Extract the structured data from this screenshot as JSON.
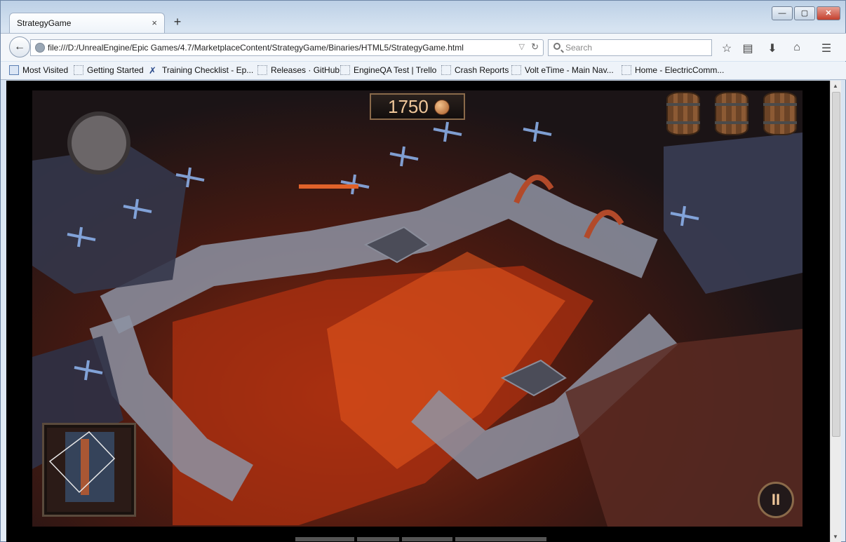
{
  "browser": {
    "tab_title": "StrategyGame",
    "tab_close": "×",
    "new_tab": "+",
    "window_buttons": {
      "minimize": "—",
      "maximize": "▢",
      "close": "✕"
    },
    "url": "file:///D:/UnrealEngine/Epic Games/4.7/MarketplaceContent/StrategyGame/Binaries/HTML5/StrategyGame.html",
    "search_placeholder": "Search",
    "back": "←",
    "reload": "↻",
    "dropdown": "▽",
    "toolbar_icons": [
      "star-icon",
      "reading-list-icon",
      "download-icon",
      "home-icon",
      "menu-icon"
    ]
  },
  "bookmarks": [
    "Most Visited",
    "Getting Started",
    "Training Checklist - Ep...",
    "Releases · GitHub",
    "EngineQA Test | Trello",
    "Crash Reports",
    "Volt eTime - Main Nav...",
    "Home - ElectricComm..."
  ],
  "game": {
    "gold": "1750",
    "barrels": 3,
    "pause": "II"
  }
}
